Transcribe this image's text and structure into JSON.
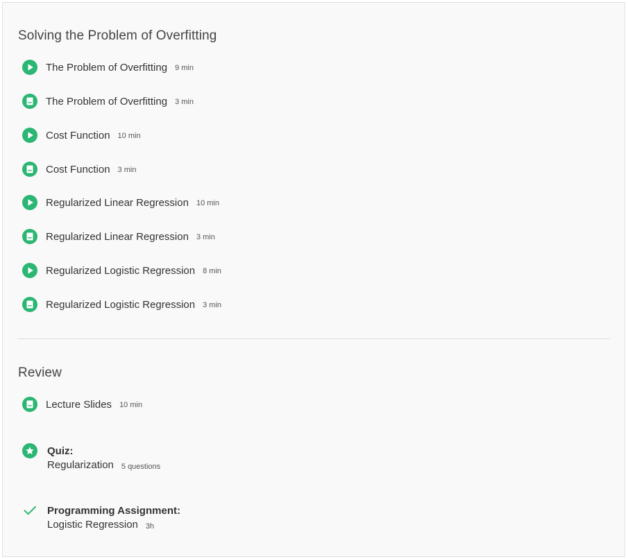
{
  "sections": [
    {
      "title": "Solving the Problem of Overfitting",
      "items": [
        {
          "icon": "play-icon",
          "label": "The Problem of Overfitting",
          "meta": "9 min"
        },
        {
          "icon": "reading-icon",
          "label": "The Problem of Overfitting",
          "meta": "3 min"
        },
        {
          "icon": "play-icon",
          "label": "Cost Function",
          "meta": "10 min"
        },
        {
          "icon": "reading-icon",
          "label": "Cost Function",
          "meta": "3 min"
        },
        {
          "icon": "play-icon",
          "label": "Regularized Linear Regression",
          "meta": "10 min"
        },
        {
          "icon": "reading-icon",
          "label": "Regularized Linear Regression",
          "meta": "3 min"
        },
        {
          "icon": "play-icon",
          "label": "Regularized Logistic Regression",
          "meta": "8 min"
        },
        {
          "icon": "reading-icon",
          "label": "Regularized Logistic Regression",
          "meta": "3 min"
        }
      ]
    },
    {
      "title": "Review",
      "items": [
        {
          "icon": "reading-icon",
          "label": "Lecture Slides",
          "meta": "10 min"
        }
      ],
      "assessments": [
        {
          "icon": "star-icon",
          "type": "Quiz:",
          "name": "Regularization",
          "meta": "5 questions"
        },
        {
          "icon": "checkmark-icon",
          "type": "Programming Assignment:",
          "name": "Logistic Regression",
          "meta": "3h"
        }
      ]
    }
  ],
  "colors": {
    "accent": "#2bb673",
    "panel_background": "#f9f9f9",
    "border": "#e1e1e1",
    "text": "#333333"
  }
}
